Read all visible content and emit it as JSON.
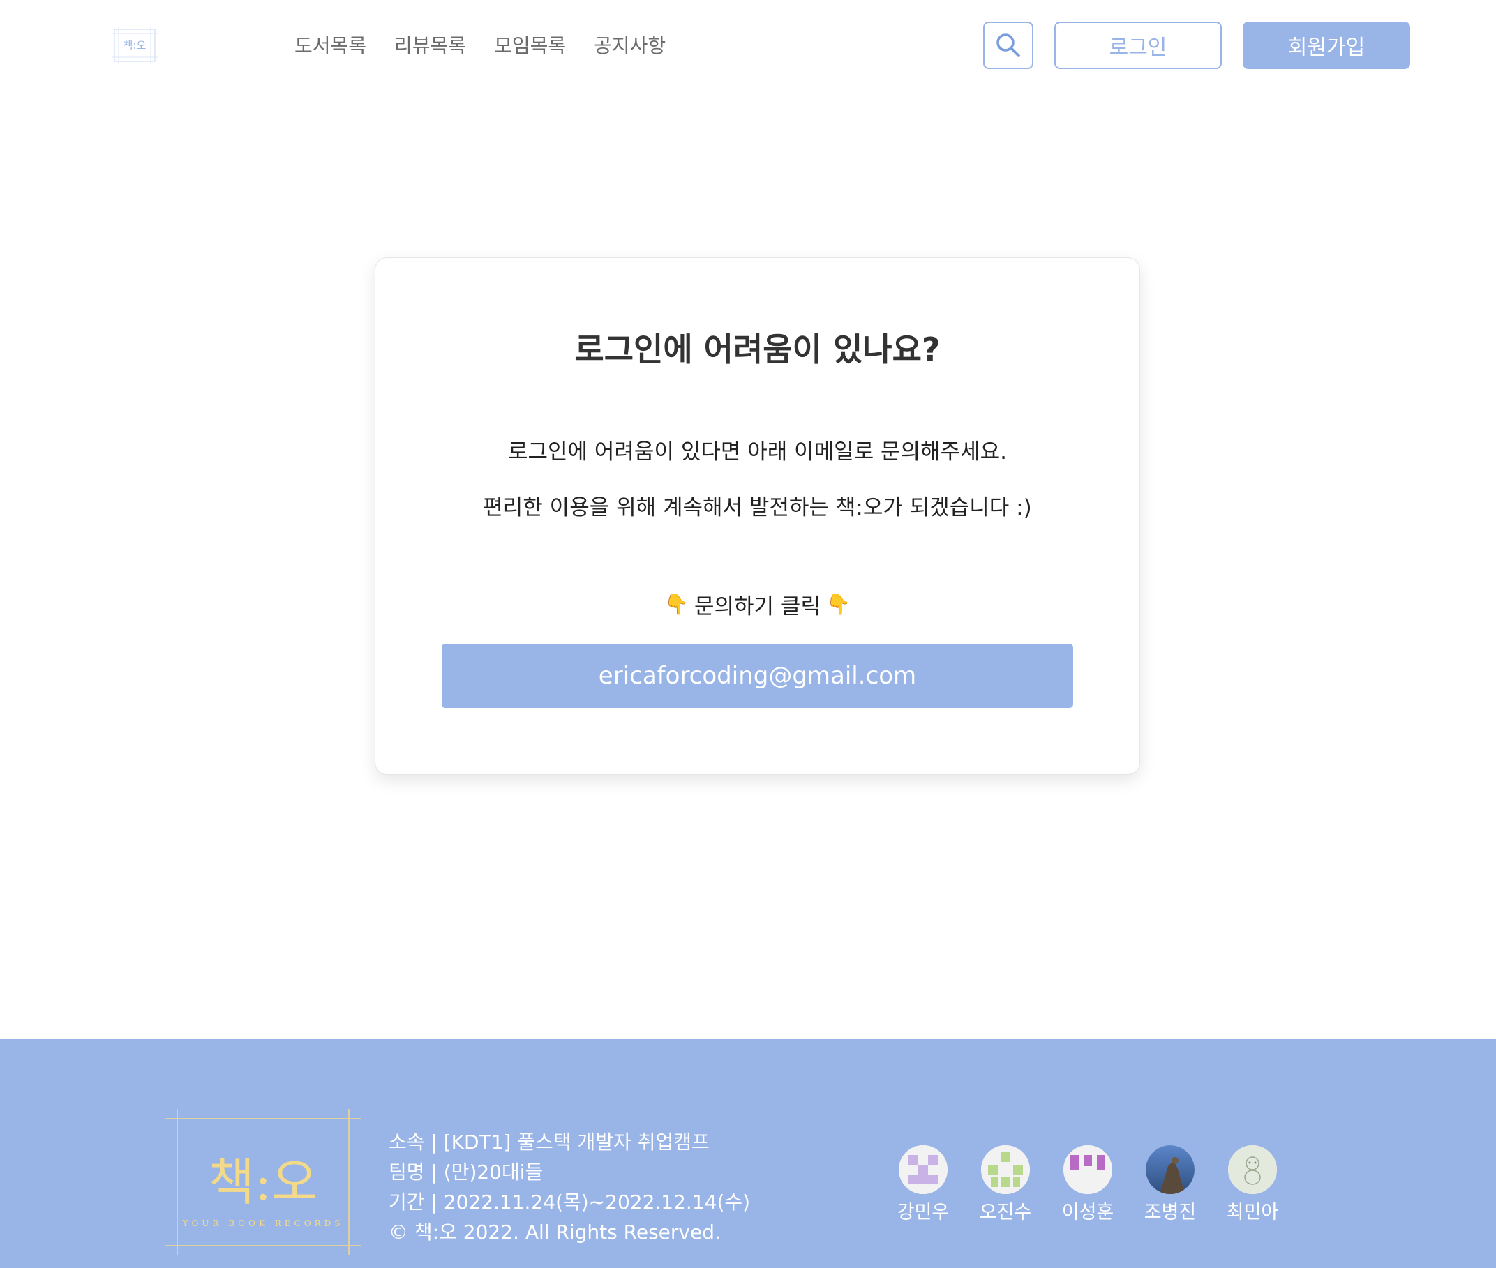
{
  "header": {
    "logo_text": "책:오",
    "nav": [
      {
        "label": "도서목록"
      },
      {
        "label": "리뷰목록"
      },
      {
        "label": "모임목록"
      },
      {
        "label": "공지사항"
      }
    ],
    "login_label": "로그인",
    "signup_label": "회원가입"
  },
  "card": {
    "title": "로그인에 어려움이 있나요?",
    "desc1": "로그인에 어려움이 있다면 아래 이메일로 문의해주세요.",
    "desc2": "편리한 이용을 위해 계속해서 발전하는 책:오가 되겠습니다 :)",
    "inquiry_label": "문의하기 클릭",
    "finger_emoji": "👇",
    "email": "ericaforcoding@gmail.com"
  },
  "footer": {
    "logo_title": "책:오",
    "logo_subtitle": "YOUR BOOK RECORDS",
    "info": [
      "소속 | [KDT1] 풀스택 개발자 취업캠프",
      "팀명 | (만)20대i들",
      "기간 | 2022.11.24(목)~2022.12.14(수)",
      "© 책:오 2022. All Rights Reserved."
    ],
    "members": [
      {
        "name": "강민우"
      },
      {
        "name": "오진수"
      },
      {
        "name": "이성훈"
      },
      {
        "name": "조병진"
      },
      {
        "name": "최민아"
      }
    ]
  },
  "colors": {
    "accent": "#99b4e6",
    "logo_gold": "#f3d98a",
    "text_dark": "#333333",
    "nav_text": "#6b6b6b"
  },
  "icons": {
    "search": "search-icon",
    "finger": "pointing-down-emoji"
  }
}
